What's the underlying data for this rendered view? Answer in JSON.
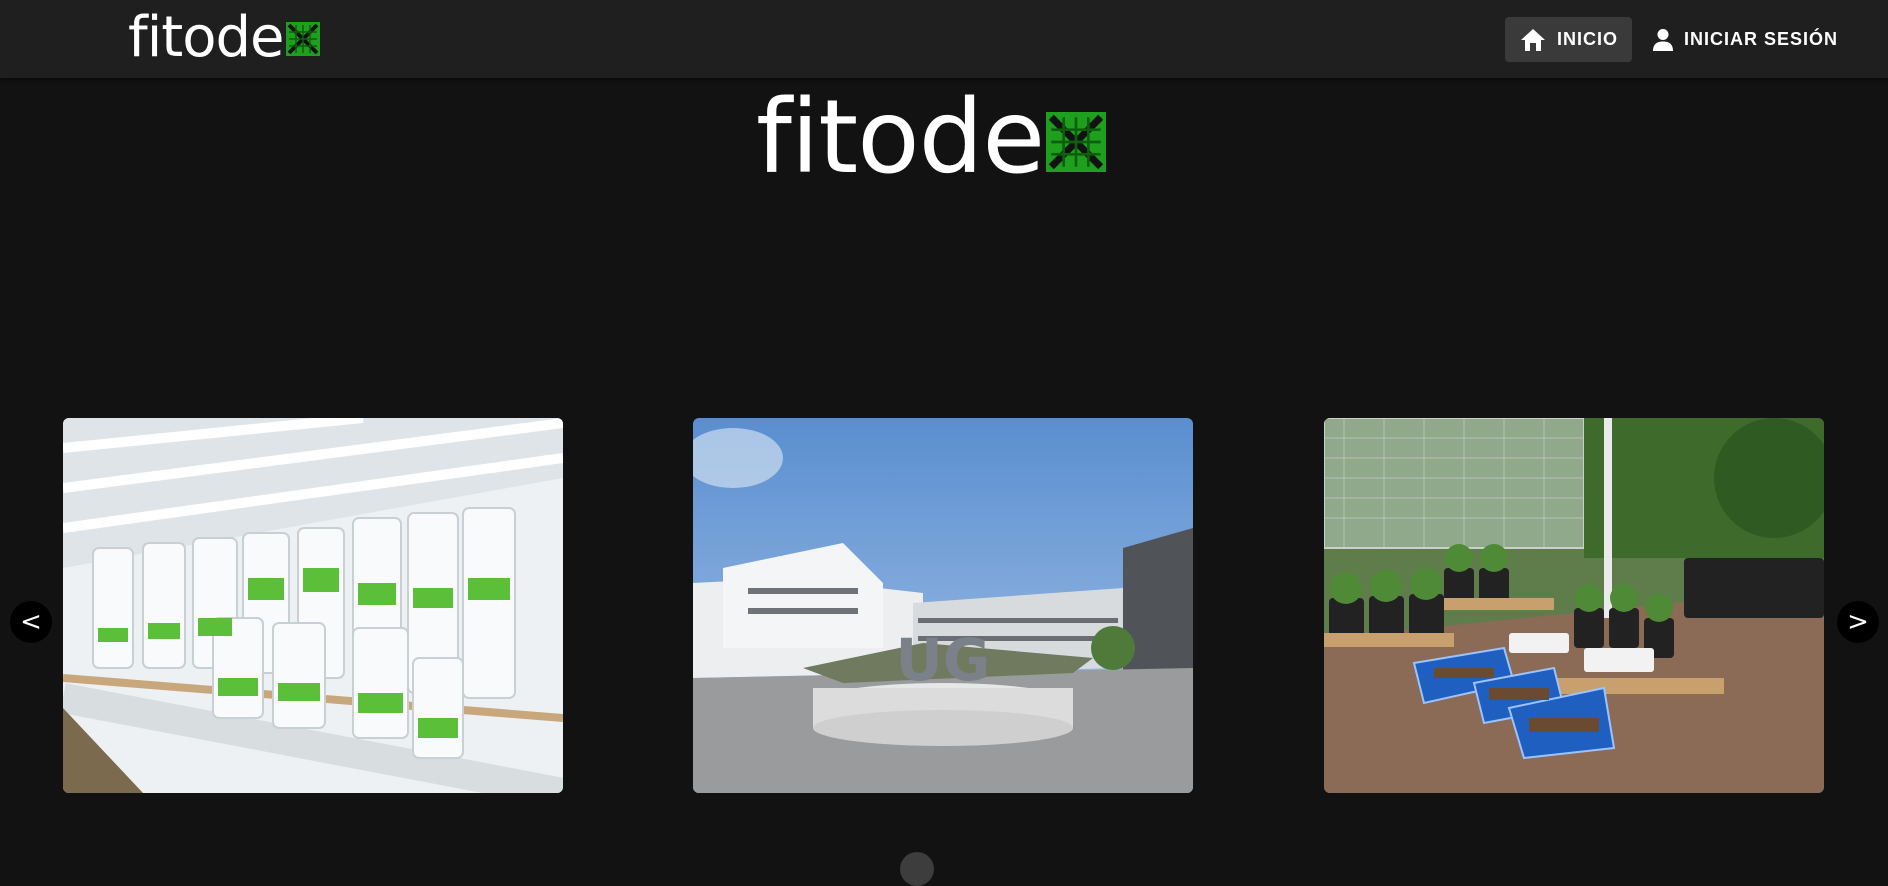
{
  "brand": {
    "name": "fitode",
    "mark_color": "#1ea01e"
  },
  "nav": {
    "items": [
      {
        "label": "INICIO",
        "icon": "home-icon",
        "active": true
      },
      {
        "label": "INICIAR SESIÓN",
        "icon": "user-icon",
        "active": false
      }
    ]
  },
  "carousel": {
    "prev_label": "<",
    "next_label": ">",
    "slides": [
      {
        "name": "lab-shelves-with-plant-jars"
      },
      {
        "name": "ug-campus-sign",
        "sign_text": "UG"
      },
      {
        "name": "nursery-with-potted-plants"
      }
    ],
    "dot_count": 1
  },
  "colors": {
    "background": "#121212",
    "topbar": "#1f1f1f",
    "accent": "#1ea01e"
  }
}
